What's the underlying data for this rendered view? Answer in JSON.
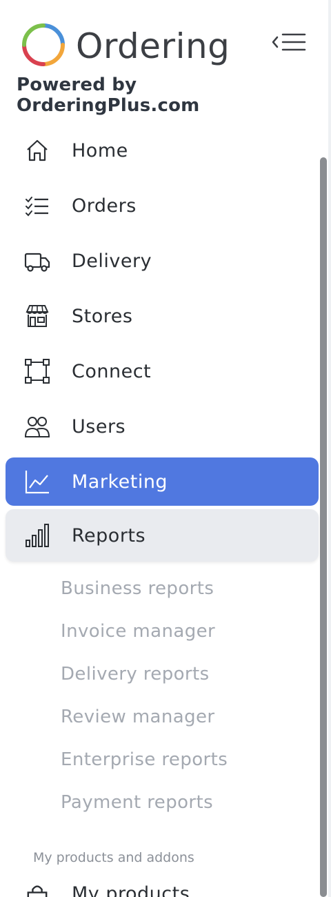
{
  "app": {
    "logo_text": "Ordering",
    "powered_by": "Powered by OrderingPlus.com",
    "logo_colors": [
      "#4a90d9",
      "#7cc04b",
      "#f2a63b",
      "#d9414f"
    ]
  },
  "header": {
    "collapse_icon": "collapse-menu-icon"
  },
  "nav": {
    "items": [
      {
        "label": "Home",
        "icon": "home-icon"
      },
      {
        "label": "Orders",
        "icon": "orders-list-icon"
      },
      {
        "label": "Delivery",
        "icon": "truck-icon"
      },
      {
        "label": "Stores",
        "icon": "store-icon"
      },
      {
        "label": "Connect",
        "icon": "connect-icon"
      },
      {
        "label": "Users",
        "icon": "users-icon"
      },
      {
        "label": "Marketing",
        "icon": "line-chart-icon",
        "state": "active"
      },
      {
        "label": "Reports",
        "icon": "bar-chart-icon",
        "state": "expanded"
      }
    ],
    "reports_submenu": [
      "Business reports",
      "Invoice manager",
      "Delivery reports",
      "Review manager",
      "Enterprise reports",
      "Payment reports"
    ]
  },
  "section": {
    "label": "My products and addons",
    "item_label": "My products",
    "item_icon": "shopping-bag-icon"
  },
  "colors": {
    "active_bg": "#5078e0",
    "expanded_bg": "#e9ebef",
    "sub_text": "#a4a9b1"
  }
}
